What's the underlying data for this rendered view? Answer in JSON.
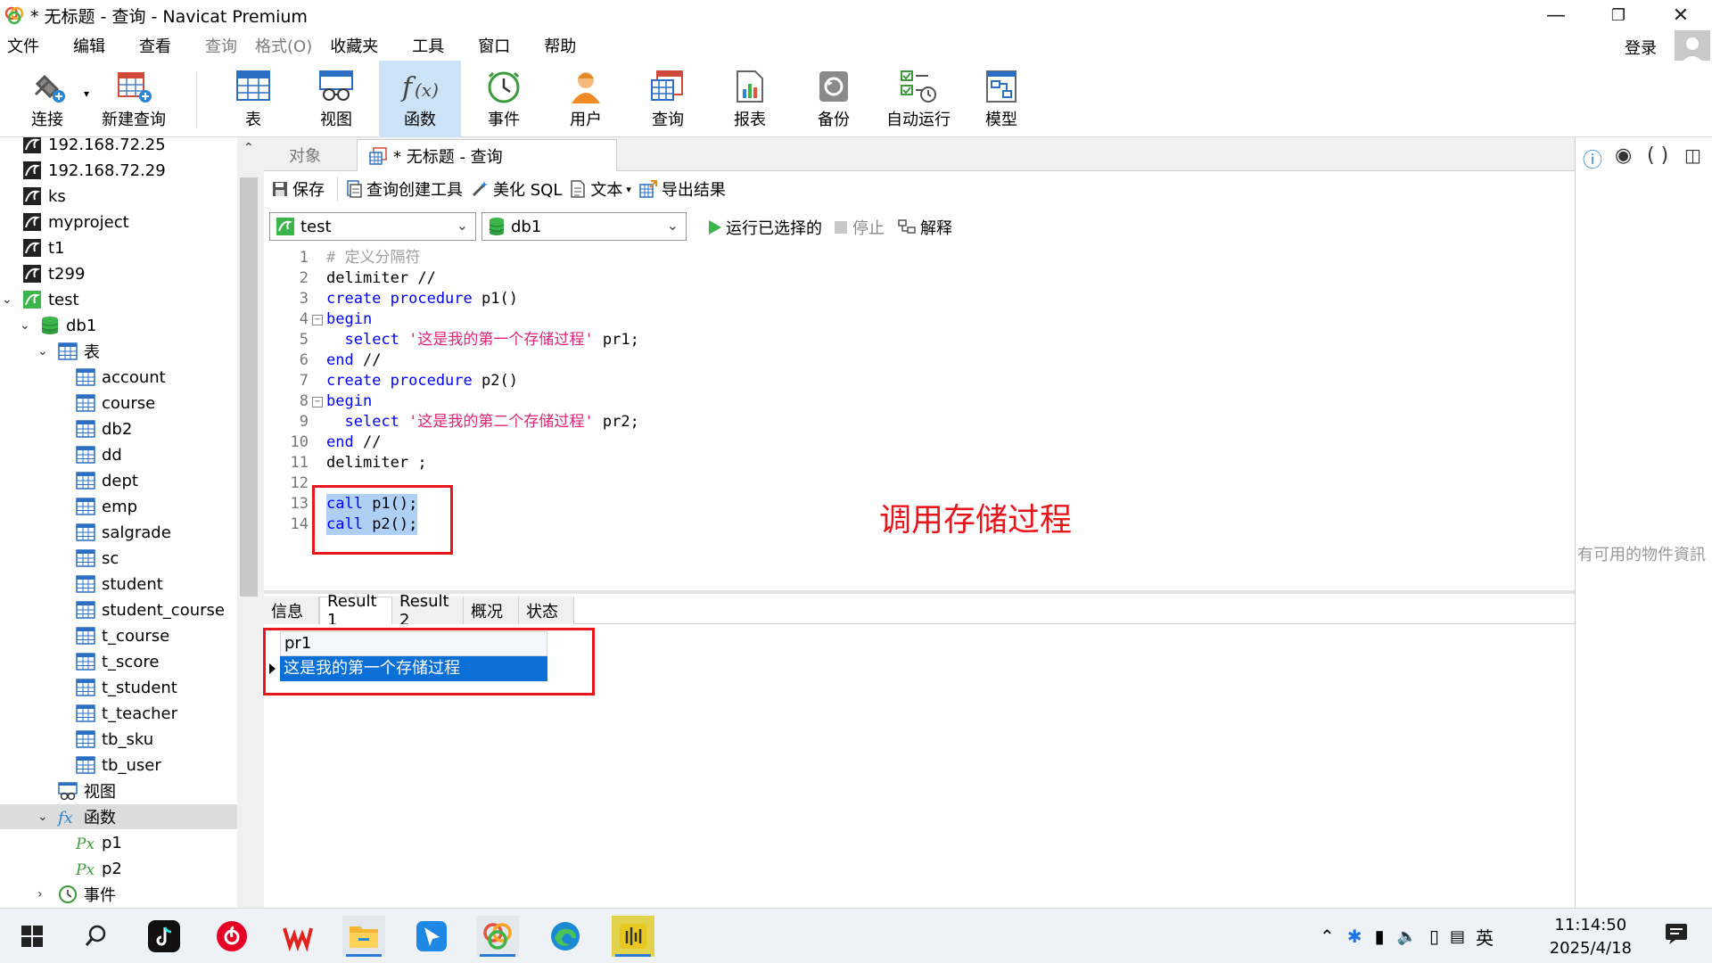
{
  "window": {
    "title": "* 无标题 - 查询 - Navicat Premium"
  },
  "menu": [
    "文件",
    "编辑",
    "查看",
    "查询",
    "格式(O)",
    "收藏夹",
    "工具",
    "窗口",
    "帮助"
  ],
  "menu_dim": [
    false,
    false,
    false,
    true,
    true,
    false,
    false,
    false,
    false
  ],
  "account": {
    "login_label": "登录"
  },
  "toolbar": {
    "connect": "连接",
    "new_query": "新建查询",
    "table": "表",
    "view": "视图",
    "function": "函数",
    "event": "事件",
    "user": "用户",
    "query": "查询",
    "report": "报表",
    "backup": "备份",
    "automation": "自动运行",
    "model": "模型"
  },
  "sidebar": {
    "connections": [
      "192.168.72.25",
      "192.168.72.29",
      "ks",
      "myproject",
      "t1",
      "t299",
      "test"
    ],
    "database": "db1",
    "tables_group": "表",
    "tables": [
      "account",
      "course",
      "db2",
      "dd",
      "dept",
      "emp",
      "salgrade",
      "sc",
      "student",
      "student_course",
      "t_course",
      "t_score",
      "t_student",
      "t_teacher",
      "tb_sku",
      "tb_user"
    ],
    "views_group": "视图",
    "functions_group": "函数",
    "functions": [
      "p1",
      "p2"
    ],
    "events_group": "事件"
  },
  "tabs": {
    "objects": "对象",
    "query_tab": "* 无标题 - 查询"
  },
  "query_toolbar": {
    "save": "保存",
    "builder": "查询创建工具",
    "beautify": "美化 SQL",
    "text": "文本",
    "export": "导出结果",
    "run_selected": "运行已选择的",
    "stop": "停止",
    "explain": "解释"
  },
  "connection_select": {
    "connection": "test",
    "database": "db1"
  },
  "editor": {
    "lines": [
      "# 定义分隔符",
      "delimiter //",
      "create procedure p1()",
      "begin",
      "  select '这是我的第一个存储过程' pr1;",
      "end //",
      "create procedure p2()",
      "begin",
      "  select '这是我的第二个存储过程' pr2;",
      "end //",
      "delimiter ;",
      "",
      "call p1();",
      "call p2();"
    ],
    "annotation": "调用存储过程"
  },
  "results": {
    "tabs": [
      "信息",
      "Result 1",
      "Result 2",
      "概况",
      "状态"
    ],
    "active_tab": "Result 1",
    "column": "pr1",
    "value": "这是我的第一个存储过程"
  },
  "right_panel": {
    "message": "有可用的物件資訊"
  },
  "taskbar": {
    "time": "11:14:50",
    "date": "2025/4/18",
    "ime": "英"
  }
}
